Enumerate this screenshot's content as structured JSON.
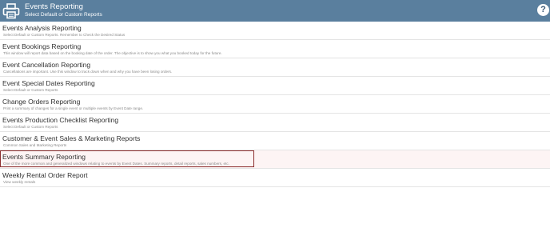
{
  "header": {
    "title": "Events Reporting",
    "subtitle": "Select Default or Custom Reports",
    "icon": "printer-icon",
    "help_icon_text": "?",
    "background_color": "#5a7f9e"
  },
  "reports": [
    {
      "title": "Events Analysis Reporting",
      "description": "Select Default or Custom Reports. Remember to Check the Desired Status"
    },
    {
      "title": "Event Bookings Reporting",
      "description": "This window will report data based on the booking date of the order. The objective is to show you what you booked today for the future."
    },
    {
      "title": "Event Cancellation Reporting",
      "description": "Cancellations are important. Use this window to track down when and why you have been losing orders."
    },
    {
      "title": "Event Special Dates Reporting",
      "description": "Select Default or Custom Reports"
    },
    {
      "title": "Change Orders Reporting",
      "description": "Print a summary of changes for a single event or multiple events by Event Date range."
    },
    {
      "title": "Events Production Checklist Reporting",
      "description": "Select Default or Custom Reports"
    },
    {
      "title": "Customer & Event Sales & Marketing Reports",
      "description": "Common Sales and Marketing Reports"
    },
    {
      "title": "Events Summary Reporting",
      "description": "One of the more common and generalized windows relating to events by Event Dates. Summary reports, detail reports, sales numbers, etc.",
      "highlighted": true
    },
    {
      "title": "Weekly Rental Order Report",
      "description": "View weekly rentals"
    }
  ],
  "highlight_color": "#8b2e2e"
}
